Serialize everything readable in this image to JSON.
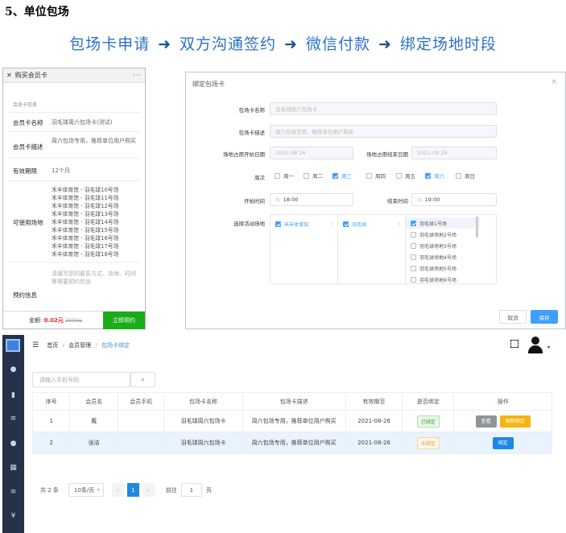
{
  "heading": "5、单位包场",
  "flow": {
    "s1": "包场卡申请",
    "s2": "双方沟通签约",
    "s3": "微信付款",
    "s4": "绑定场地时段",
    "arrow": "➜"
  },
  "phone": {
    "close": "✕",
    "title": "购买会员卡",
    "more": "···",
    "section": "会员卡信息",
    "name_label": "会员卡名称",
    "name_value": "羽毛球周六包场卡(测试)",
    "desc_label": "会员卡描述",
    "desc_value": "周六包场专用，推荐单位用户购买",
    "validity_label": "有效期限",
    "validity_value": "12个月",
    "venues_label": "可使用场地",
    "venues": [
      "禾丰体育馆 - 羽毛球10号场",
      "禾丰体育馆 - 羽毛球11号场",
      "禾丰体育馆 - 羽毛球12号场",
      "禾丰体育馆 - 羽毛球13号场",
      "禾丰体育馆 - 羽毛球14号场",
      "禾丰体育馆 - 羽毛球15号场",
      "禾丰体育馆 - 羽毛球16号场",
      "禾丰体育馆 - 羽毛球17号场",
      "禾丰体育馆 - 羽毛球18号场"
    ],
    "booking_label": "预约信息",
    "booking_placeholder": "请填写您的联系方式、场地、时间等需要预约信息",
    "amount_label": "金额:",
    "amount": "0.02元",
    "amount_orig": "2000元",
    "buy": "立即预约"
  },
  "modal": {
    "title": "绑定包场卡",
    "close": "×",
    "card_name_label": "包场卡名称",
    "card_name": "羽毛球周六包场卡",
    "card_desc_label": "包场卡描述",
    "card_desc": "周六包场专用，推荐单位用户购买",
    "start_date_label": "场地占用开始日期",
    "start_date": "2020-08-26",
    "end_date_label": "场地占用结束日期",
    "end_date": "2021-08-26",
    "week_label": "周次",
    "days": [
      "周一",
      "周二",
      "周三",
      "周四",
      "周五",
      "周六",
      "周日"
    ],
    "start_time_label": "开始时间",
    "start_time": "18:00",
    "end_time_label": "结束时间",
    "end_time": "19:00",
    "venue_label": "选择活动场地",
    "tree_venue": "禾丰体育馆",
    "tree_sport": "羽毛球",
    "courts": [
      "羽毛球1号场",
      "羽毛球场地2号场",
      "羽毛球场地3号场",
      "羽毛球场地4号场",
      "羽毛球场地5号场",
      "羽毛球场地6号场"
    ],
    "cancel": "取消",
    "save": "保存",
    "clock": "◷",
    "arrow": "›"
  },
  "admin": {
    "menu_icon": "☰",
    "crumbs": {
      "home": "首页",
      "sep1": "/",
      "member": "会员管理",
      "sep2": "/",
      "current": "包场卡绑定"
    },
    "search_placeholder": "请输入手机号码",
    "search_icon": "⌕",
    "columns": [
      "序号",
      "会员名",
      "会员手机",
      "包场卡名称",
      "包场卡描述",
      "有效期至",
      "是否绑定",
      "操作"
    ],
    "rows": [
      {
        "no": "1",
        "name": "戴",
        "phone": "",
        "card": "羽毛球周六包场卡",
        "desc": "周六包场专用，推荐单位用户购买",
        "expire": "2021-08-26",
        "status": "已绑定",
        "ops": [
          "查看",
          "解除绑定"
        ]
      },
      {
        "no": "2",
        "name": "张洁",
        "phone": "",
        "card": "羽毛球周六包场卡",
        "desc": "周六包场专用，推荐单位用户购买",
        "expire": "2021-08-26",
        "status": "未绑定",
        "ops": [
          "绑定"
        ]
      }
    ],
    "pager": {
      "total": "共 2 条",
      "size": "10条/页",
      "prev": "‹",
      "page": "1",
      "next": "›",
      "goto": "前往",
      "goto_value": "1",
      "unit": "页"
    }
  },
  "side_icons": [
    "user-icon",
    "bar-chart-icon",
    "list-icon",
    "group-icon",
    "grid-icon",
    "doc-icon",
    "yen-icon"
  ],
  "colors": {
    "accent": "#409eff",
    "green": "#1aad19",
    "flow_blue": "#2b71c9",
    "sidebar": "#26324a"
  }
}
